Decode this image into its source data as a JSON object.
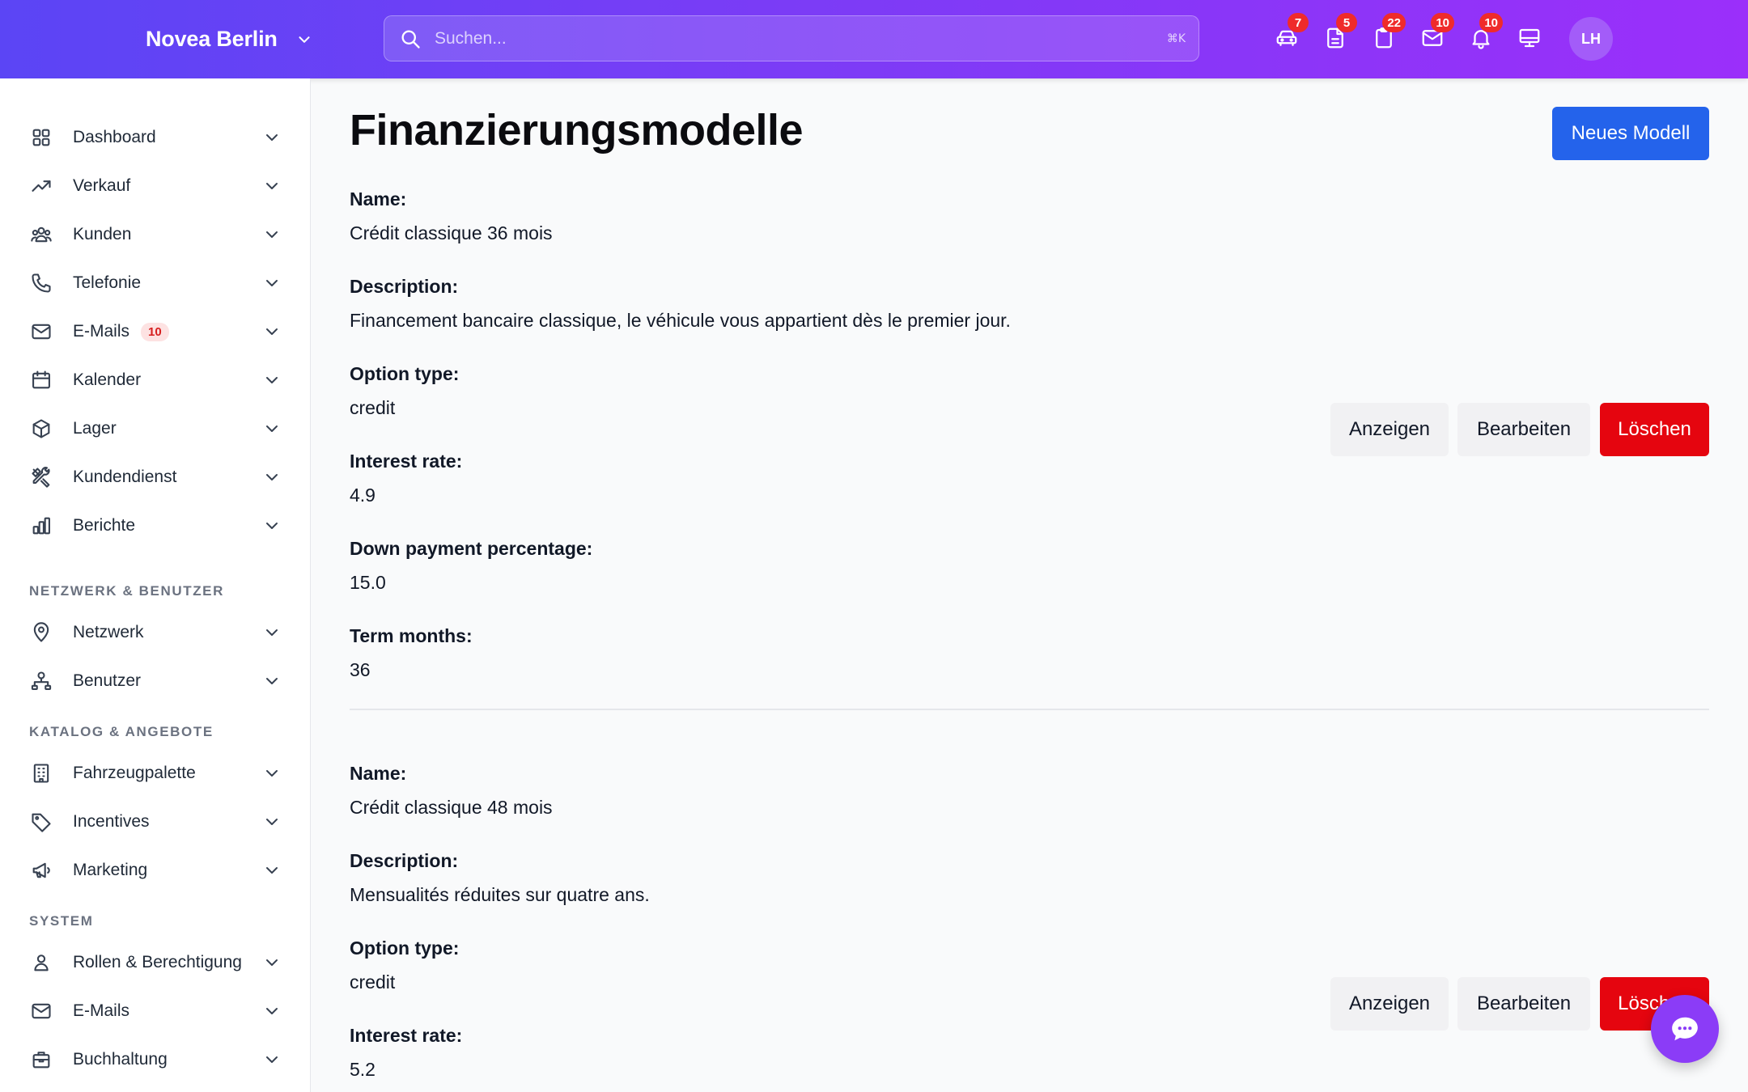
{
  "header": {
    "brand": "Novea Berlin",
    "search_placeholder": "Suchen...",
    "search_shortcut": "⌘K",
    "icons": [
      {
        "name": "car-icon",
        "badge": "7"
      },
      {
        "name": "document-icon",
        "badge": "5"
      },
      {
        "name": "clipboard-icon",
        "badge": "22"
      },
      {
        "name": "mail-icon",
        "badge": "10"
      },
      {
        "name": "bell-icon",
        "badge": "10"
      },
      {
        "name": "monitor-icon",
        "badge": ""
      }
    ],
    "avatar_initials": "LH"
  },
  "sidebar": {
    "main_items": [
      {
        "label": "Dashboard",
        "icon": "grid-icon"
      },
      {
        "label": "Verkauf",
        "icon": "trend-up-icon"
      },
      {
        "label": "Kunden",
        "icon": "users-icon"
      },
      {
        "label": "Telefonie",
        "icon": "phone-icon"
      },
      {
        "label": "E-Mails",
        "icon": "mail-icon",
        "badge": "10"
      },
      {
        "label": "Kalender",
        "icon": "calendar-icon"
      },
      {
        "label": "Lager",
        "icon": "box-icon"
      },
      {
        "label": "Kundendienst",
        "icon": "tools-icon"
      },
      {
        "label": "Berichte",
        "icon": "bar-chart-icon"
      }
    ],
    "sections": [
      {
        "title": "NETZWERK & BENUTZER",
        "items": [
          {
            "label": "Netzwerk",
            "icon": "map-pin-icon"
          },
          {
            "label": "Benutzer",
            "icon": "user-network-icon"
          }
        ]
      },
      {
        "title": "KATALOG & ANGEBOTE",
        "items": [
          {
            "label": "Fahrzeugpalette",
            "icon": "building-icon"
          },
          {
            "label": "Incentives",
            "icon": "tag-icon"
          },
          {
            "label": "Marketing",
            "icon": "megaphone-icon"
          }
        ]
      },
      {
        "title": "SYSTEM",
        "items": [
          {
            "label": "Rollen & Berechtigung",
            "icon": "user-icon"
          },
          {
            "label": "E-Mails",
            "icon": "mail-icon"
          },
          {
            "label": "Buchhaltung",
            "icon": "briefcase-icon"
          }
        ]
      }
    ]
  },
  "main": {
    "title": "Finanzierungsmodelle",
    "new_button": "Neues Modell",
    "labels": {
      "name": "Name:",
      "description": "Description:",
      "option_type": "Option type:",
      "interest_rate": "Interest rate:",
      "down_payment": "Down payment percentage:",
      "term_months": "Term months:"
    },
    "actions": {
      "show": "Anzeigen",
      "edit": "Bearbeiten",
      "delete": "Löschen"
    },
    "models": [
      {
        "name": "Crédit classique 36 mois",
        "description": "Financement bancaire classique, le véhicule vous appartient dès le premier jour.",
        "option_type": "credit",
        "interest_rate": "4.9",
        "down_payment": "15.0",
        "term_months": "36"
      },
      {
        "name": "Crédit classique 48 mois",
        "description": "Mensualités réduites sur quatre ans.",
        "option_type": "credit",
        "interest_rate": "5.2"
      }
    ]
  }
}
